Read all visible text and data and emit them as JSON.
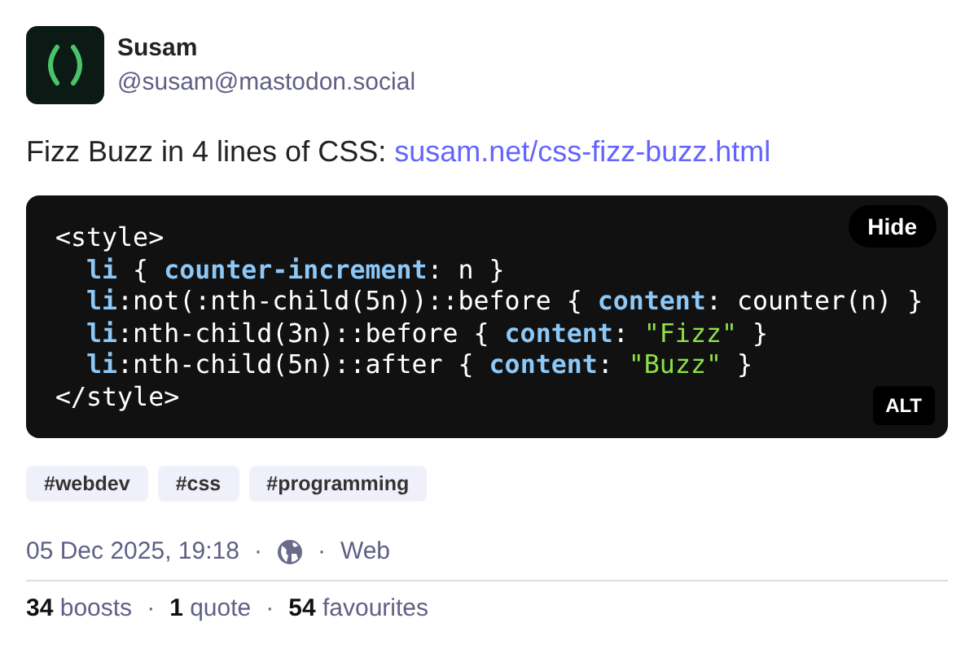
{
  "author": {
    "name": "Susam",
    "handle": "@susam@mastodon.social"
  },
  "post": {
    "text": "Fizz Buzz in 4 lines of CSS:",
    "link": "susam.net/css-fizz-buzz.html"
  },
  "media": {
    "hide_button": "Hide",
    "alt_badge": "ALT",
    "code_lines": [
      {
        "tokens": [
          {
            "text": "<style>",
            "kind": "plain"
          }
        ],
        "children": [
          {
            "tokens": [
              {
                "text": "li",
                "kind": "keyword"
              },
              {
                "text": " { ",
                "kind": "plain"
              },
              {
                "text": "counter-increment",
                "kind": "keyword"
              },
              {
                "text": ": n }",
                "kind": "plain"
              }
            ]
          },
          {
            "tokens": [
              {
                "text": "li",
                "kind": "keyword"
              },
              {
                "text": ":not(:nth-child(5n))::before { ",
                "kind": "plain"
              },
              {
                "text": "content",
                "kind": "keyword"
              },
              {
                "text": ": counter(n) }",
                "kind": "plain"
              }
            ]
          },
          {
            "tokens": [
              {
                "text": "li",
                "kind": "keyword"
              },
              {
                "text": ":nth-child(3n)::before { ",
                "kind": "plain"
              },
              {
                "text": "content",
                "kind": "keyword"
              },
              {
                "text": ": ",
                "kind": "plain"
              },
              {
                "text": "\"Fizz\"",
                "kind": "string"
              },
              {
                "text": " }",
                "kind": "plain"
              }
            ]
          },
          {
            "tokens": [
              {
                "text": "li",
                "kind": "keyword"
              },
              {
                "text": ":nth-child(5n)::after { ",
                "kind": "plain"
              },
              {
                "text": "content",
                "kind": "keyword"
              },
              {
                "text": ": ",
                "kind": "plain"
              },
              {
                "text": "\"Buzz\"",
                "kind": "string"
              },
              {
                "text": " }",
                "kind": "plain"
              }
            ]
          }
        ]
      },
      {
        "tokens": [
          {
            "text": "</style>",
            "kind": "plain"
          }
        ]
      }
    ]
  },
  "tags": [
    "#webdev",
    "#css",
    "#programming"
  ],
  "meta": {
    "date": "05 Dec 2025, 19:18",
    "separator": "·",
    "source": "Web"
  },
  "stats": [
    {
      "count": "34",
      "label": "boosts"
    },
    {
      "count": "1",
      "label": "quote"
    },
    {
      "count": "54",
      "label": "favourites"
    }
  ]
}
